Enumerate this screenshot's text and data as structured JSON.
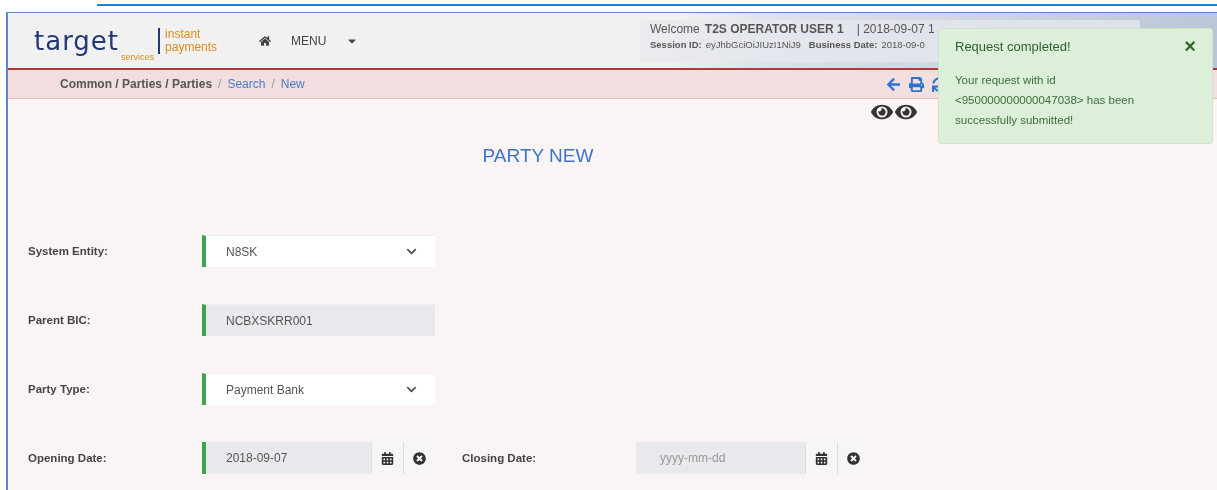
{
  "logo": {
    "brand": "target",
    "sub": "services",
    "product_line1": "instant",
    "product_line2": "payments"
  },
  "nav": {
    "menu": "MENU"
  },
  "user": {
    "welcome": "Welcome",
    "name": "T2S OPERATOR USER 1",
    "datetime": "| 2018-09-07 1",
    "session_label": "Session ID:",
    "session_value": "eyJhbGciOiJIUzI1NiJ9",
    "business_label": "Business Date:",
    "business_value": "2018-09-0"
  },
  "breadcrumb_separator": "/",
  "breadcrumb": [
    {
      "label": "Common / Parties / Parties",
      "link": false
    },
    {
      "label": "Search",
      "link": true
    },
    {
      "label": "New",
      "link": true
    }
  ],
  "page_title": "PARTY NEW",
  "fields": [
    {
      "label": "System Entity:",
      "kind": "select",
      "value": "N8SK",
      "required": true
    },
    {
      "label": "Parent BIC:",
      "kind": "readonly",
      "value": "NCBXSKRR001",
      "required": true
    },
    {
      "label": "Party Type:",
      "kind": "select",
      "value": "Payment Bank",
      "required": true
    }
  ],
  "dates": [
    {
      "label": "Opening Date:",
      "value": "2018-09-07",
      "required": true
    },
    {
      "label": "Closing Date:",
      "placeholder": "yyyy-mm-dd",
      "required": false
    }
  ],
  "toast": {
    "title": "Request completed!",
    "close": "×",
    "message": "Your request with id <950000000000047038> has been successfully submitted!"
  }
}
